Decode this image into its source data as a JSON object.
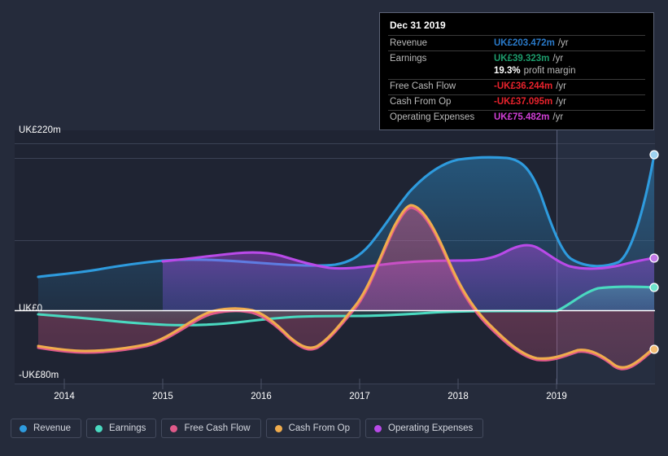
{
  "chart_data": {
    "type": "area",
    "title": "",
    "xlabel": "",
    "ylabel": "",
    "currency": "UK£",
    "unit": "m",
    "ylim": [
      -80,
      220
    ],
    "y_ticks": [
      {
        "value": 220,
        "label": "UK£220m"
      },
      {
        "value": 0,
        "label": "UK£0"
      },
      {
        "value": -80,
        "label": "-UK£80m"
      }
    ],
    "x_ticks": [
      "2014",
      "2015",
      "2016",
      "2017",
      "2018",
      "2019"
    ],
    "x_range": [
      "2013.4",
      "2020.1"
    ],
    "grid": true,
    "legend_position": "bottom",
    "series": [
      {
        "name": "Revenue",
        "color": "#2e9bde",
        "x": [
          2013.45,
          2014.0,
          2014.5,
          2015.0,
          2015.5,
          2016.0,
          2016.5,
          2017.0,
          2017.5,
          2018.0,
          2018.3,
          2018.6,
          2019.0,
          2019.3,
          2019.6,
          2020.05
        ],
        "values": [
          38,
          40,
          49,
          53,
          54,
          53,
          50,
          54,
          110,
          165,
          180,
          183,
          105,
          84,
          83,
          203.472
        ]
      },
      {
        "name": "Earnings",
        "color": "#4ad9c0",
        "x": [
          2013.45,
          2014.0,
          2014.5,
          2015.0,
          2015.5,
          2016.0,
          2016.5,
          2017.0,
          2017.5,
          2018.0,
          2018.5,
          2019.0,
          2019.5,
          2020.05
        ],
        "values": [
          3,
          1,
          -3,
          -7,
          -9,
          -6,
          -4,
          -3,
          -2,
          -1,
          -2,
          -2,
          18,
          39.323
        ]
      },
      {
        "name": "Free Cash Flow",
        "color": "#e05a8a",
        "x": [
          2013.45,
          2014.0,
          2014.5,
          2015.0,
          2015.5,
          2016.0,
          2016.5,
          2017.0,
          2017.5,
          2018.0,
          2018.5,
          2019.0,
          2019.4,
          2020.05
        ],
        "values": [
          -42,
          -46,
          -43,
          -39,
          -3,
          -1,
          -23,
          40,
          116,
          15,
          -55,
          -43,
          -70,
          -36.244
        ]
      },
      {
        "name": "Cash From Op",
        "color": "#f0ac4d",
        "x": [
          2013.45,
          2014.0,
          2014.5,
          2015.0,
          2015.5,
          2016.0,
          2016.5,
          2017.0,
          2017.5,
          2018.0,
          2018.5,
          2019.0,
          2019.4,
          2020.05
        ],
        "values": [
          -41,
          -45,
          -42,
          -38,
          -2,
          0,
          -22,
          41,
          118,
          16,
          -54,
          -42,
          -69,
          -37.095
        ]
      },
      {
        "name": "Operating Expenses",
        "color": "#b94ae8",
        "x": [
          2015.0,
          2015.5,
          2016.0,
          2016.5,
          2017.0,
          2017.5,
          2018.0,
          2018.3,
          2018.6,
          2019.0,
          2019.5,
          2020.05
        ],
        "values": [
          60,
          66,
          68,
          62,
          52,
          51,
          52,
          72,
          70,
          55,
          53,
          75.482
        ]
      }
    ]
  },
  "tooltip": {
    "title": "Dec 31 2019",
    "rows": [
      {
        "name": "Revenue",
        "value": "UK£203.472m",
        "unit": "/yr",
        "color": "#2979c8"
      },
      {
        "name": "Earnings",
        "value": "UK£39.323m",
        "unit": "/yr",
        "color": "#1d9c6c"
      },
      {
        "name": "",
        "value": "19.3%",
        "unit": "profit margin",
        "color": "#ffffff"
      },
      {
        "name": "Free Cash Flow",
        "value": "-UK£36.244m",
        "unit": "/yr",
        "color": "#e8222c"
      },
      {
        "name": "Cash From Op",
        "value": "-UK£37.095m",
        "unit": "/yr",
        "color": "#e8222c"
      },
      {
        "name": "Operating Expenses",
        "value": "UK£75.482m",
        "unit": "/yr",
        "color": "#d13fd6"
      }
    ]
  },
  "legend": {
    "items": [
      {
        "label": "Revenue",
        "color": "#2e9bde"
      },
      {
        "label": "Earnings",
        "color": "#4ad9c0"
      },
      {
        "label": "Free Cash Flow",
        "color": "#e05a8a"
      },
      {
        "label": "Cash From Op",
        "color": "#f0ac4d"
      },
      {
        "label": "Operating Expenses",
        "color": "#b94ae8"
      }
    ]
  },
  "colors": {
    "background": "#252b3b",
    "plot_background": "#1f2433",
    "grid": "#3b4255",
    "zero_line": "#ffffff",
    "axis_text": "#ffffff"
  }
}
